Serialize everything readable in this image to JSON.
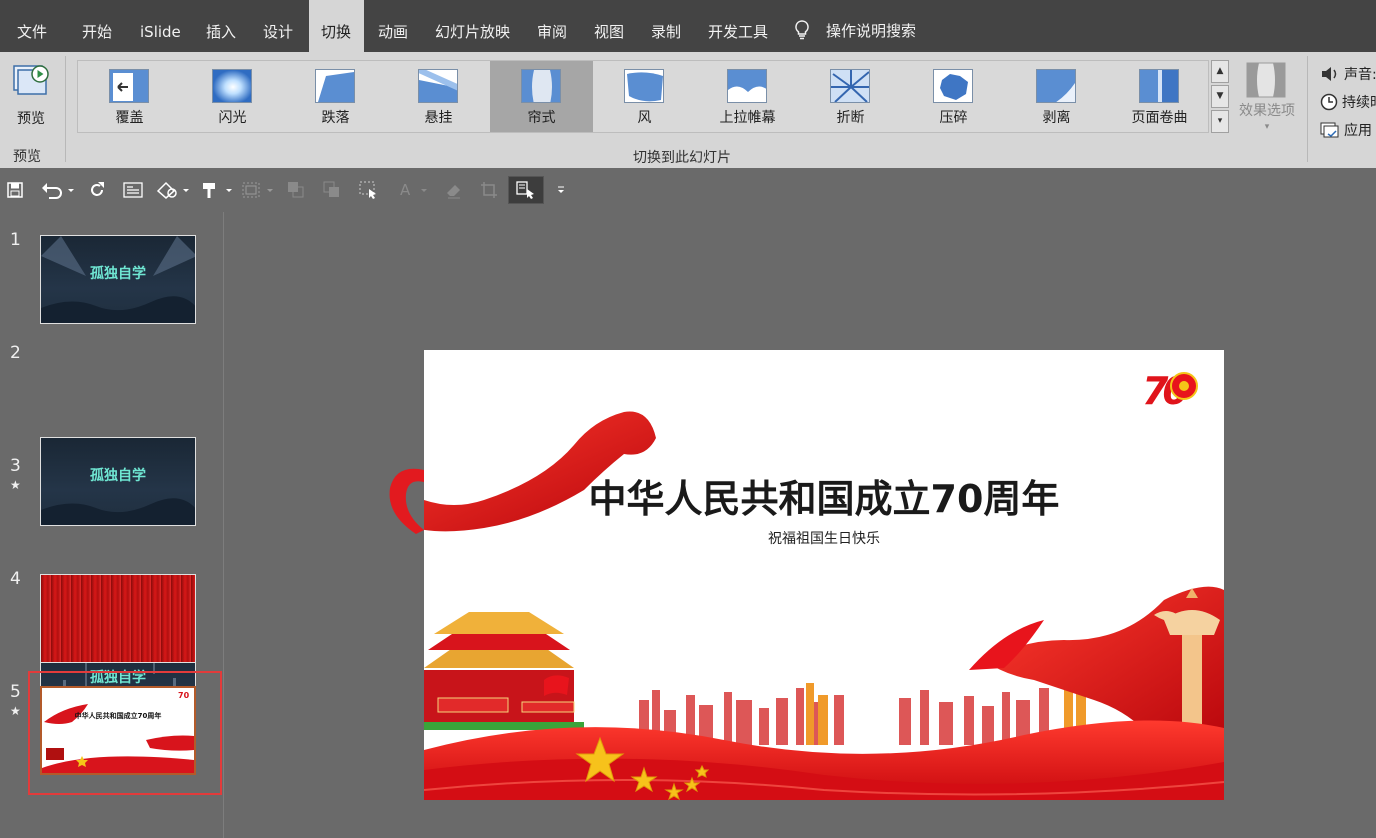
{
  "menu": {
    "tabs": [
      "文件",
      "开始",
      "iSlide",
      "插入",
      "设计",
      "切换",
      "动画",
      "幻灯片放映",
      "审阅",
      "视图",
      "录制",
      "开发工具"
    ],
    "active_tab": "切换",
    "search_label": "操作说明搜索"
  },
  "ribbon": {
    "preview_label": "预览",
    "preview_group_label": "预览",
    "transitions_group_label": "切换到此幻灯片",
    "transitions": [
      "覆盖",
      "闪光",
      "跌落",
      "悬挂",
      "帘式",
      "风",
      "上拉帷幕",
      "折断",
      "压碎",
      "剥离",
      "页面卷曲"
    ],
    "selected_transition": "帘式",
    "effect_options_label": "效果选项",
    "sound_label": "声音:",
    "duration_label": "持续时",
    "apply_label": "应用"
  },
  "slides": {
    "numbers": [
      "1",
      "2",
      "3",
      "4",
      "5"
    ],
    "selected": "5",
    "star": "★",
    "slide1_title": "孤独自学",
    "slide2_title": "孤独自学",
    "slide3_title": "孤独自学",
    "slide5_title": "中华人民共和国成立70周年"
  },
  "main_slide": {
    "title": "中华人民共和国成立70周年",
    "subtitle": "祝福祖国生日快乐",
    "logo_text": "70"
  },
  "colors": {
    "menu_bg": "#444444",
    "ribbon_bg": "#d6d6d6",
    "workspace_bg": "#6a6a6a",
    "selection_red": "#e23b3b",
    "festive_red": "#d8141c",
    "teal_title": "#6fe6d2"
  }
}
